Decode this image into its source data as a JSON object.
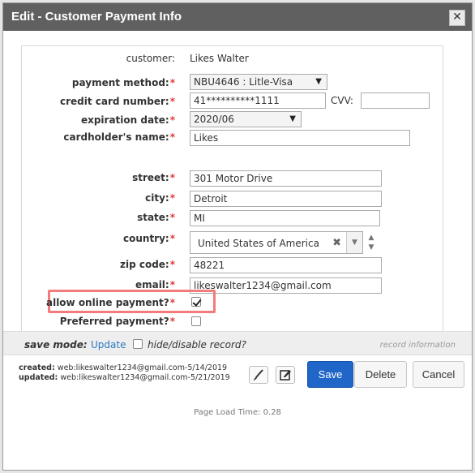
{
  "titlebar": {
    "title": "Edit - Customer Payment Info",
    "close_glyph": "✕"
  },
  "form": {
    "customer": {
      "label": "customer:",
      "value": "Likes Walter"
    },
    "payment_method": {
      "label": "payment method:",
      "value": "NBU4646 : Litle-Visa"
    },
    "credit_card_number": {
      "label": "credit card number:",
      "value": "41**********1111"
    },
    "cvv": {
      "label": "CVV:",
      "value": ""
    },
    "expiration_date": {
      "label": "expiration date:",
      "value": "2020/06"
    },
    "cardholder_name": {
      "label": "cardholder's name:",
      "value": "Likes"
    },
    "street": {
      "label": "street:",
      "value": "301 Motor Drive"
    },
    "city": {
      "label": "city:",
      "value": "Detroit"
    },
    "state": {
      "label": "state:",
      "value": "MI"
    },
    "country": {
      "label": "country:",
      "value": "United States of America"
    },
    "zip_code": {
      "label": "zip code:",
      "value": "48221"
    },
    "email": {
      "label": "email:",
      "value": "likeswalter1234@gmail.com"
    },
    "allow_online_payment": {
      "label": "allow online payment?",
      "checked": true
    },
    "preferred_payment": {
      "label": "Preferred payment?",
      "checked": false
    },
    "required_mark": "*"
  },
  "savebar": {
    "mode_label": "save mode:",
    "mode_value": "Update",
    "hide_label": "hide/disable record?",
    "record_info": "record information"
  },
  "audit": {
    "created_label": "created:",
    "created_value": "web:likeswalter1234@gmail.com-5/14/2019",
    "updated_label": "updated:",
    "updated_value": "web:likeswalter1234@gmail.com-5/21/2019"
  },
  "buttons": {
    "save": "Save",
    "delete": "Delete",
    "cancel": "Cancel"
  },
  "footer": {
    "load_time": "Page Load Time: 0.28"
  },
  "colors": {
    "titlebar": "#606060",
    "primary": "#1f66c8",
    "required": "#e03a3a",
    "highlight": "#f47b7b",
    "link": "#2a7ac2"
  }
}
